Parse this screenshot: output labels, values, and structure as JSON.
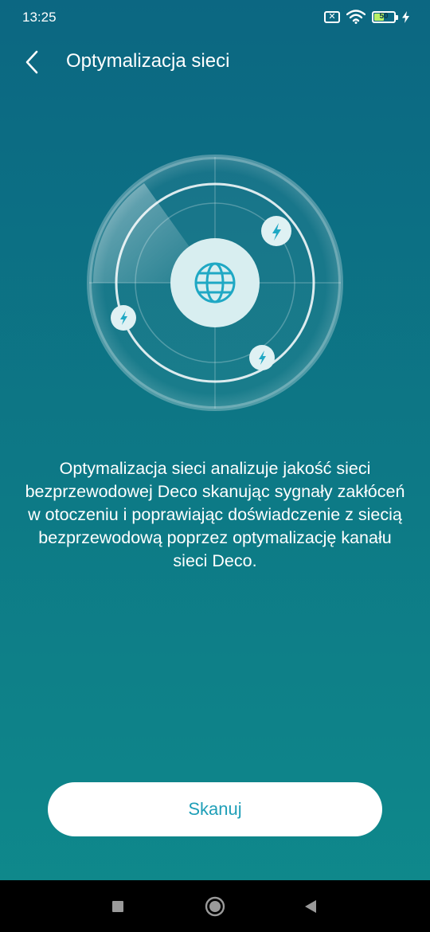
{
  "status_bar": {
    "time": "13:25",
    "sim_glyph": "✕",
    "battery_level": "50",
    "icons": [
      "sim-x-icon",
      "wifi-icon",
      "battery-icon",
      "charging-bolt-icon"
    ]
  },
  "header": {
    "back_icon": "chevron-left-icon",
    "title": "Optymalizacja sieci"
  },
  "illustration": {
    "center_icon": "globe-icon",
    "node_icon": "lightning-icon"
  },
  "description": "Optymalizacja sieci analizuje jakość sieci bezprzewodowej Deco skanując sygnały zakłóceń w otoczeniu i poprawiając doświadczenie z siecią bezprzewodową poprzez optymalizację kanału sieci Deco.",
  "scan_button": {
    "label": "Skanuj"
  },
  "nav_bar": {
    "icons": [
      "recents-square-icon",
      "home-circle-icon",
      "back-triangle-icon"
    ]
  },
  "colors": {
    "background_top": "#0c6782",
    "background_bottom": "#0f8a8c",
    "button_text": "#1f9fb8",
    "battery_fill": "#b9f065"
  }
}
